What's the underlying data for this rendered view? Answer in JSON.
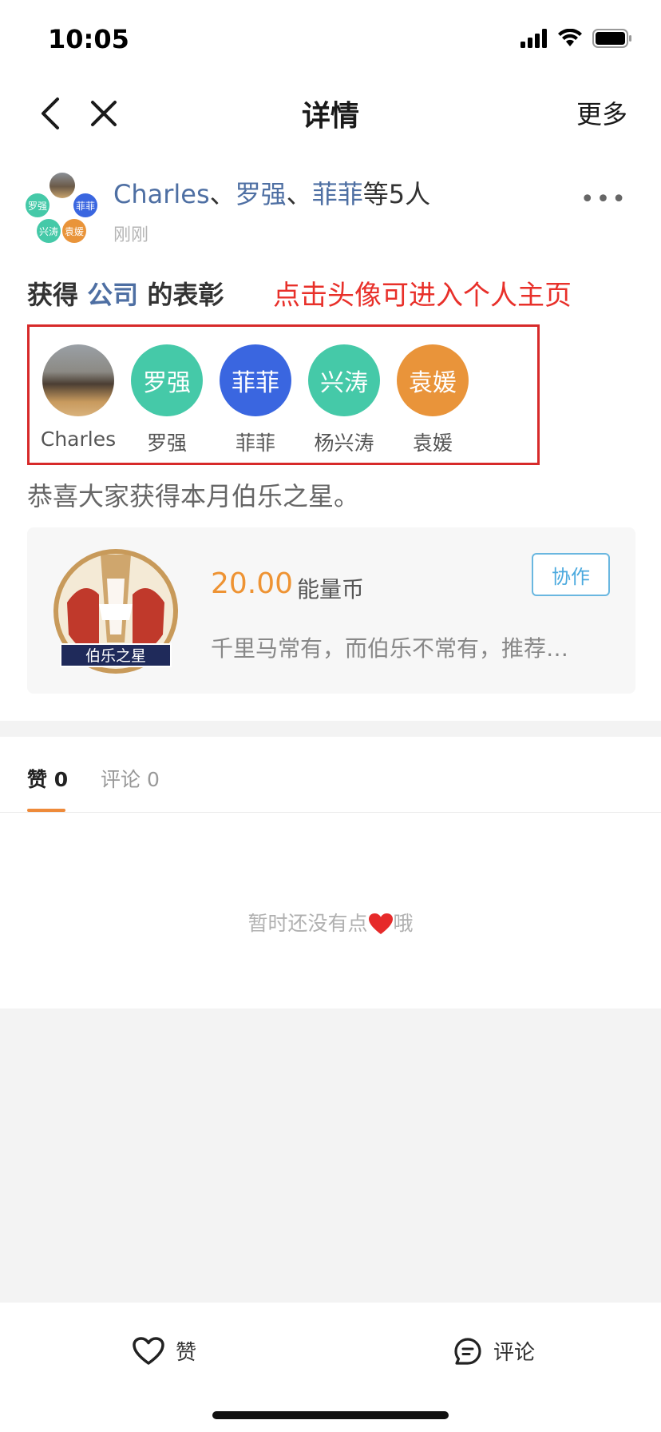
{
  "status_bar": {
    "time": "10:05"
  },
  "nav": {
    "title": "详情",
    "more": "更多"
  },
  "post": {
    "names": [
      "Charles",
      "罗强",
      "菲菲"
    ],
    "separator": "、",
    "suffix": "等5人",
    "time": "刚刚",
    "menu": "•••",
    "group_avatar_labels": [
      "罗强",
      "菲菲",
      "兴涛",
      "袁媛"
    ]
  },
  "award": {
    "prefix": "获得",
    "company": "公司",
    "suffix": "的表彰"
  },
  "hint": "点击头像可进入个人主页",
  "recipients": [
    {
      "name": "Charles",
      "initials": "",
      "color": "photo"
    },
    {
      "name": "罗强",
      "initials": "罗强",
      "color": "#45c9a8"
    },
    {
      "name": "菲菲",
      "initials": "菲菲",
      "color": "#3a66e0"
    },
    {
      "name": "杨兴涛",
      "initials": "兴涛",
      "color": "#45c9a8"
    },
    {
      "name": "袁媛",
      "initials": "袁媛",
      "color": "#e9943a"
    }
  ],
  "congrats": "恭喜大家获得本月伯乐之星。",
  "card": {
    "medal_label": "伯乐之星",
    "amount": "20.00",
    "unit": "能量币",
    "description": "千里马常有，而伯乐不常有，推荐…",
    "button": "协作"
  },
  "tabs": {
    "like_label": "赞",
    "like_count": "0",
    "comment_label": "评论",
    "comment_count": "0"
  },
  "empty": {
    "before": "暂时还没有点",
    "after": "哦"
  },
  "bottom": {
    "like": "赞",
    "comment": "评论"
  }
}
